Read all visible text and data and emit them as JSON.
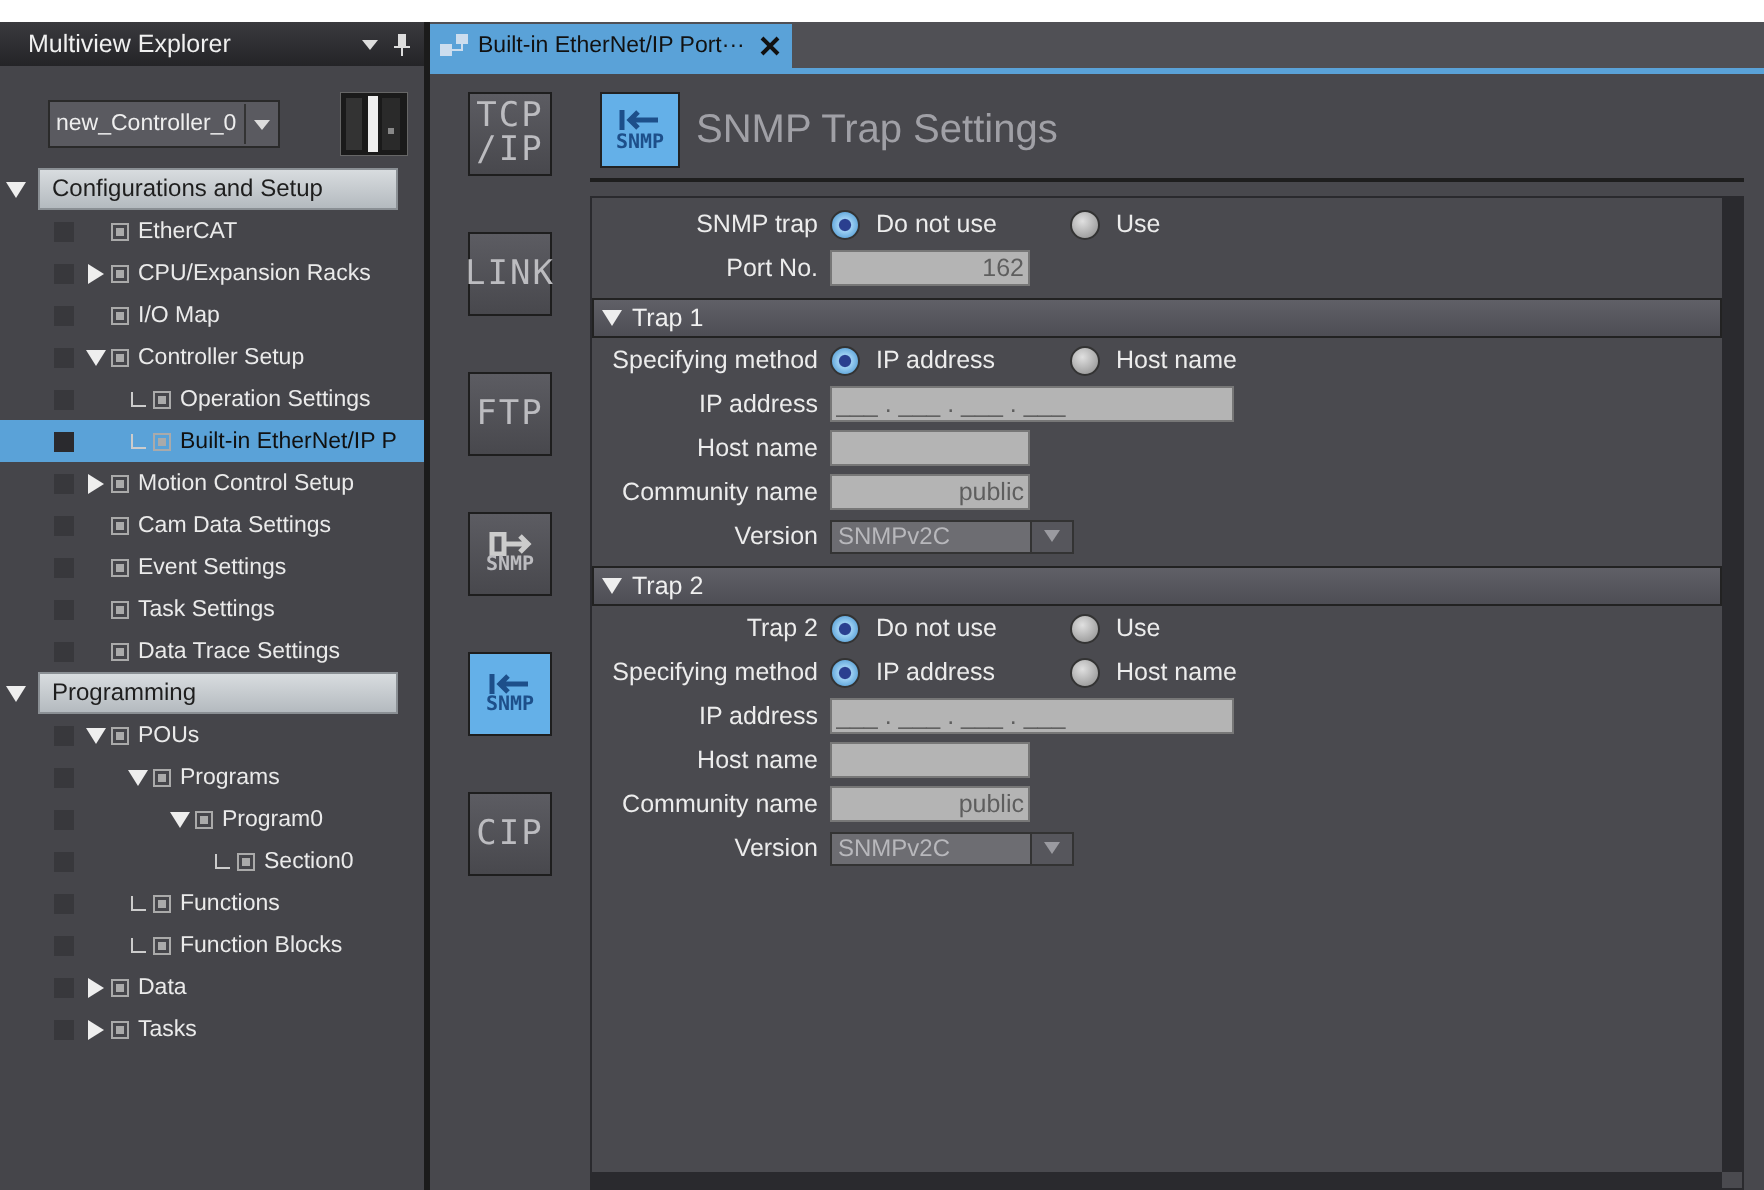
{
  "explorer": {
    "title": "Multiview Explorer",
    "controller": "new_Controller_0",
    "tree": [
      {
        "label": "Configurations and Setup",
        "kind": "section",
        "expanded": true,
        "children": [
          {
            "label": "EtherCAT",
            "kind": "plain",
            "selected": false
          },
          {
            "label": "CPU/Expansion Racks",
            "kind": "branch",
            "expanded": false,
            "selected": false
          },
          {
            "label": "I/O Map",
            "kind": "plain",
            "selected": false
          },
          {
            "label": "Controller Setup",
            "kind": "branch",
            "expanded": true,
            "selected": false,
            "children": [
              {
                "label": "Operation Settings",
                "kind": "leaf",
                "selected": false
              },
              {
                "label": "Built-in EtherNet/IP P",
                "kind": "leaf",
                "selected": true
              }
            ]
          },
          {
            "label": "Motion Control Setup",
            "kind": "branch",
            "expanded": false,
            "selected": false
          },
          {
            "label": "Cam Data Settings",
            "kind": "plain",
            "selected": false
          },
          {
            "label": "Event Settings",
            "kind": "plain",
            "selected": false
          },
          {
            "label": "Task Settings",
            "kind": "plain",
            "selected": false
          },
          {
            "label": "Data Trace Settings",
            "kind": "plain",
            "selected": false
          }
        ]
      },
      {
        "label": "Programming",
        "kind": "section",
        "expanded": true,
        "children": [
          {
            "label": "POUs",
            "kind": "branch",
            "expanded": true,
            "selected": false,
            "children": [
              {
                "label": "Programs",
                "kind": "branch",
                "expanded": true,
                "selected": false,
                "children": [
                  {
                    "label": "Program0",
                    "kind": "branch",
                    "expanded": true,
                    "selected": false,
                    "children": [
                      {
                        "label": "Section0",
                        "kind": "leaf",
                        "selected": false
                      }
                    ]
                  }
                ]
              },
              {
                "label": "Functions",
                "kind": "leaf",
                "selected": false
              },
              {
                "label": "Function Blocks",
                "kind": "leaf",
                "selected": false
              }
            ]
          },
          {
            "label": "Data",
            "kind": "branch",
            "expanded": false,
            "selected": false
          },
          {
            "label": "Tasks",
            "kind": "branch",
            "expanded": false,
            "selected": false
          }
        ]
      }
    ]
  },
  "tab": {
    "label": "Built-in EtherNet/IP Port···",
    "selected": true
  },
  "side_buttons": [
    {
      "kind": "text",
      "lines": [
        "TCP",
        "/IP"
      ],
      "selected": false
    },
    {
      "kind": "text",
      "lines": [
        "LINK"
      ],
      "selected": false
    },
    {
      "kind": "text",
      "lines": [
        "FTP"
      ],
      "selected": false
    },
    {
      "kind": "arrow-out",
      "lines": [
        "SNMP"
      ],
      "selected": false
    },
    {
      "kind": "arrow-in",
      "lines": [
        "SNMP"
      ],
      "selected": true
    },
    {
      "kind": "text",
      "lines": [
        "CIP"
      ],
      "selected": false
    }
  ],
  "page": {
    "title": "SNMP Trap Settings",
    "icon_label": "SNMP"
  },
  "general": {
    "fields": [
      {
        "kind": "radio",
        "label": "SNMP trap",
        "options": [
          {
            "label": "Do not use",
            "selected": true
          },
          {
            "label": "Use",
            "selected": false
          }
        ]
      },
      {
        "kind": "text",
        "label": "Port No.",
        "value": "162",
        "disabled": true
      }
    ]
  },
  "traps": [
    {
      "title": "Trap 1",
      "expanded": true,
      "fields": [
        {
          "kind": "radio",
          "label": "Specifying method",
          "options": [
            {
              "label": "IP address",
              "selected": true
            },
            {
              "label": "Host name",
              "selected": false
            }
          ]
        },
        {
          "kind": "ip",
          "label": "IP address",
          "placeholder": "___ . ___ . ___ . ___",
          "disabled": true
        },
        {
          "kind": "text",
          "label": "Host name",
          "disabled": true
        },
        {
          "kind": "text",
          "label": "Community name",
          "value": "public",
          "disabled": true
        },
        {
          "kind": "select",
          "label": "Version",
          "value": "SNMPv2C",
          "disabled": true
        }
      ]
    },
    {
      "title": "Trap 2",
      "expanded": true,
      "fields": [
        {
          "kind": "radio",
          "label": "Trap 2",
          "options": [
            {
              "label": "Do not use",
              "selected": true
            },
            {
              "label": "Use",
              "selected": false
            }
          ]
        },
        {
          "kind": "radio",
          "label": "Specifying method",
          "options": [
            {
              "label": "IP address",
              "selected": true
            },
            {
              "label": "Host name",
              "selected": false
            }
          ]
        },
        {
          "kind": "ip",
          "label": "IP address",
          "placeholder": "___ . ___ . ___ . ___",
          "disabled": true
        },
        {
          "kind": "text",
          "label": "Host name",
          "disabled": true
        },
        {
          "kind": "text",
          "label": "Community name",
          "value": "public",
          "disabled": true
        },
        {
          "kind": "select",
          "label": "Version",
          "value": "SNMPv2C",
          "disabled": true
        }
      ]
    }
  ]
}
